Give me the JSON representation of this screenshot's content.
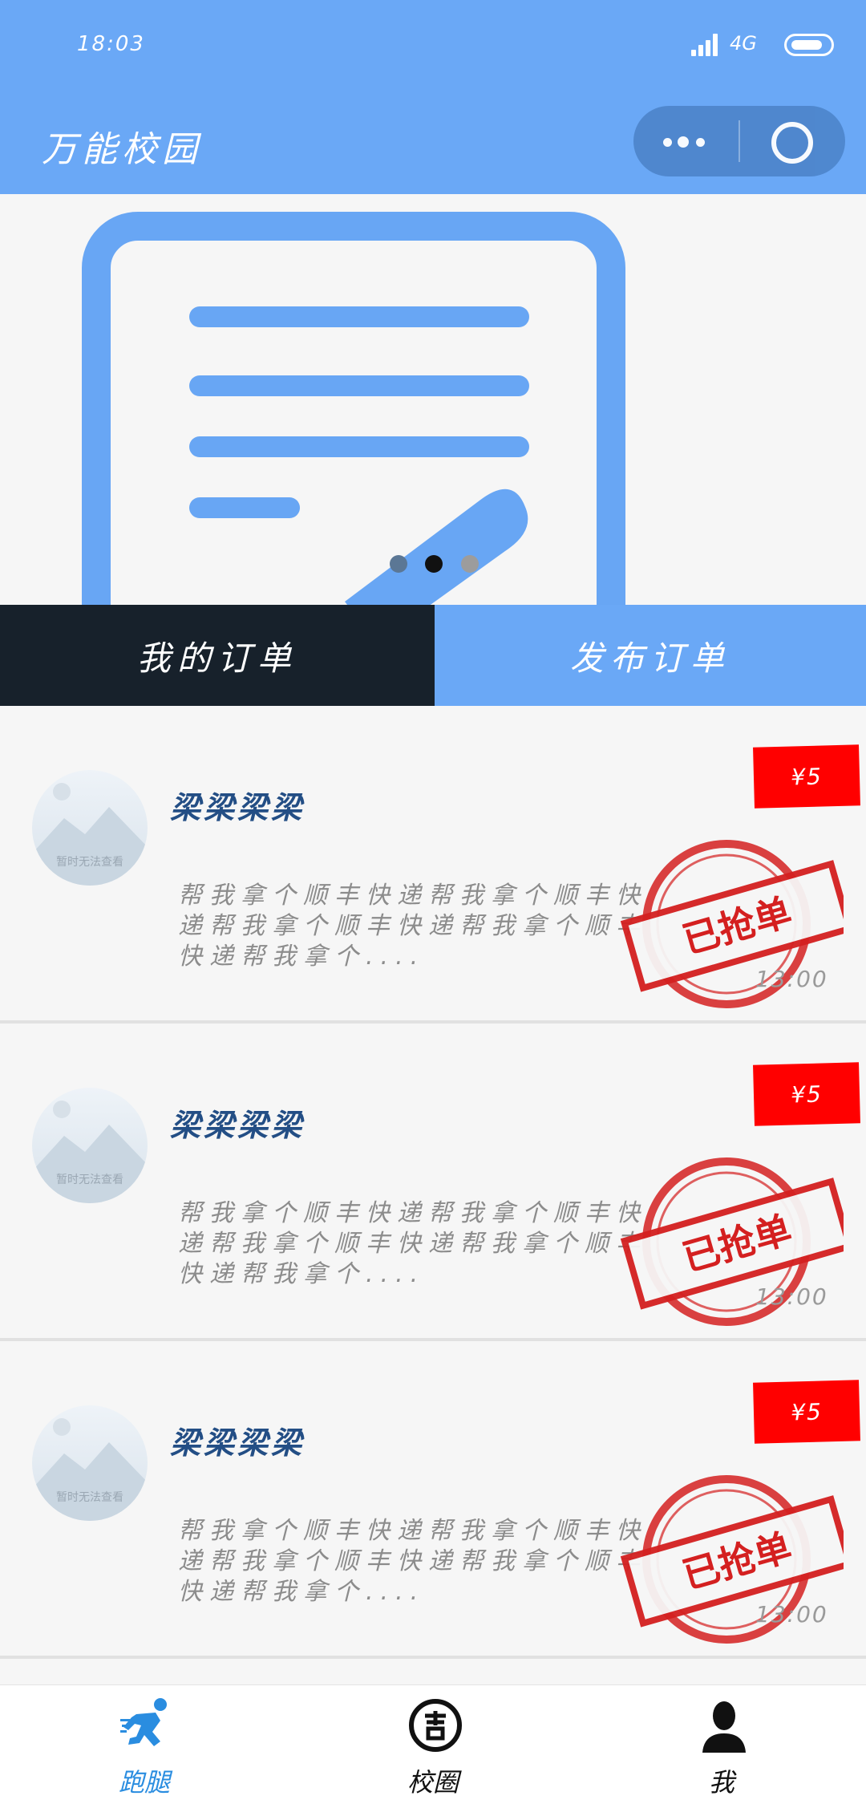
{
  "status_bar": {
    "time": "18:03",
    "network": "4G"
  },
  "header": {
    "title": "万能校园"
  },
  "banner": {
    "dots": 3,
    "active_dot": 2
  },
  "tabs": [
    {
      "label": "我的订单"
    },
    {
      "label": "发布订单"
    }
  ],
  "orders": [
    {
      "name": "梁梁梁梁",
      "avatar_placeholder": "暂时无法查看",
      "description": "帮我拿个顺丰快递帮我拿个顺丰快递帮我拿个顺丰快递帮我拿个顺丰快递帮我拿个....",
      "price": "¥5",
      "stamp": "已抢单",
      "time": "13:00"
    },
    {
      "name": "梁梁梁梁",
      "avatar_placeholder": "暂时无法查看",
      "description": "帮我拿个顺丰快递帮我拿个顺丰快递帮我拿个顺丰快递帮我拿个顺丰快递帮我拿个....",
      "price": "¥5",
      "stamp": "已抢单",
      "time": "13:00"
    },
    {
      "name": "梁梁梁梁",
      "avatar_placeholder": "暂时无法查看",
      "description": "帮我拿个顺丰快递帮我拿个顺丰快递帮我拿个顺丰快递帮我拿个顺丰快递帮我拿个....",
      "price": "¥5",
      "stamp": "已抢单",
      "time": "13:00"
    }
  ],
  "tabbar": [
    {
      "label": "跑腿",
      "icon": "runner-icon",
      "active": true
    },
    {
      "label": "校圈",
      "icon": "campus-circle-icon",
      "active": false
    },
    {
      "label": "我",
      "icon": "user-icon",
      "active": false
    }
  ],
  "colors": {
    "primary": "#6aa8f6",
    "dark_tab": "#17212b",
    "price": "#ff0000",
    "stamp": "#d42020",
    "name": "#234e85"
  }
}
